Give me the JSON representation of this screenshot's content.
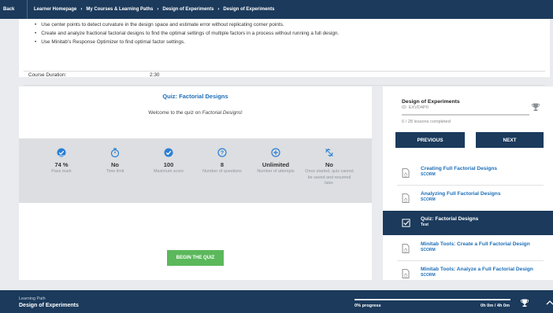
{
  "topbar": {
    "back_label": "Back",
    "breadcrumbs": [
      "Learner Homepage",
      "My Courses & Learning Paths",
      "Design of Experiments",
      "Design of Experiments"
    ]
  },
  "course_info": {
    "bullets": [
      "Use center points to detect curvature in the design space and estimate error without replicating corner points.",
      "Create and analyze fractional factorial designs to find the optimal settings of multiple factors in a process without running a full design.",
      "Use Minitab's Response Optimizer to find optimal factor settings."
    ],
    "duration_label": "Course Duration:",
    "duration_value": "2:30"
  },
  "quiz": {
    "title": "Quiz: Factorial Designs",
    "welcome_prefix": "Welcome to the quiz on ",
    "welcome_topic": "Factorial Designs",
    "welcome_suffix": "!",
    "stats": [
      {
        "icon": "pass-mark-check-icon",
        "value": "74 %",
        "label": "Pass mark"
      },
      {
        "icon": "stopwatch-icon",
        "value": "No",
        "label": "Time limit"
      },
      {
        "icon": "check-circle-icon",
        "value": "100",
        "label": "Maximum score"
      },
      {
        "icon": "question-circle-icon",
        "value": "8",
        "label": "Number of questions"
      },
      {
        "icon": "plus-circle-icon",
        "value": "Unlimited",
        "label": "Number of attempts"
      },
      {
        "icon": "no-resume-icon",
        "value": "No",
        "label": "Once started, quiz cannot be saved and resumed later."
      }
    ],
    "begin_label": "BEGIN THE QUIZ"
  },
  "sidebar": {
    "title": "Design of Experiments",
    "id_text": "ID: EXVD4P0",
    "progress": 0,
    "lessons_completed": "0 / 28 lessons completed",
    "previous_label": "PREVIOUS",
    "next_label": "NEXT",
    "lessons": [
      {
        "title": "Creating Full Factorial Designs",
        "type": "SCORM",
        "icon": "document-icon",
        "active": false
      },
      {
        "title": "Analyzing Full Factorial Designs",
        "type": "SCORM",
        "icon": "document-icon",
        "active": false
      },
      {
        "title": "Quiz: Factorial Designs",
        "type": "Test",
        "icon": "checkbox-icon",
        "active": true
      },
      {
        "title": "Minitab Tools: Create a Full Factorial Design",
        "type": "SCORM",
        "icon": "document-icon",
        "active": false
      },
      {
        "title": "Minitab Tools: Analyze a Full Factorial Design",
        "type": "SCORM",
        "icon": "document-icon",
        "active": false
      }
    ]
  },
  "footer": {
    "label": "Learning Path",
    "name": "Design of Experiments",
    "progress_text": "0% progress",
    "progress": 0,
    "time_text": "0h 0m / 4h 0m"
  },
  "colors": {
    "navy": "#1b3a5c",
    "link_blue": "#1d6fb8",
    "accent_blue": "#2a7fd4",
    "button_green": "#5bb85b"
  }
}
